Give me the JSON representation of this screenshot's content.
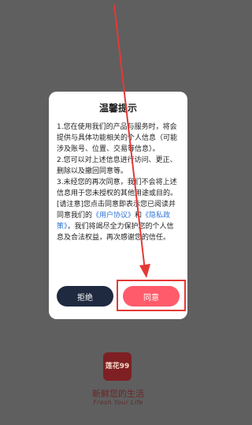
{
  "dialog": {
    "title": "温馨提示",
    "paragraphs": {
      "p1": "1.您在使用我们的产品与服务时，将会提供与具体功能相关的个人信息（可能涉及账号、位置、交易等信息）。",
      "p2": "2.您可以对上述信息进行访问、更正、删除以及撤回同意等。",
      "p3": "3.未经您的再次同意，我们不会将上述信息用于您未授权的其他用途或目的。"
    },
    "notice_prefix": "[请注意]您点击同意即表示您已阅读并同意我们的",
    "user_agreement_link": "《用户协议》",
    "and_text": "和",
    "privacy_policy_link": "《隐私政策》",
    "notice_suffix": "，我们将竭尽全力保护您的个人信息及合法权益，再次感谢您的信任。",
    "reject_label": "拒绝",
    "agree_label": "同意"
  },
  "app": {
    "logo_text": "莲花99",
    "tagline": "新鲜您的生活",
    "tagline_en": "Fresh Your Life"
  },
  "colors": {
    "overlay": "#5f5f5f",
    "reject_button": "#1f2940",
    "agree_button": "#ff5b6b",
    "link": "#2f74d6",
    "highlight": "#e53935"
  }
}
